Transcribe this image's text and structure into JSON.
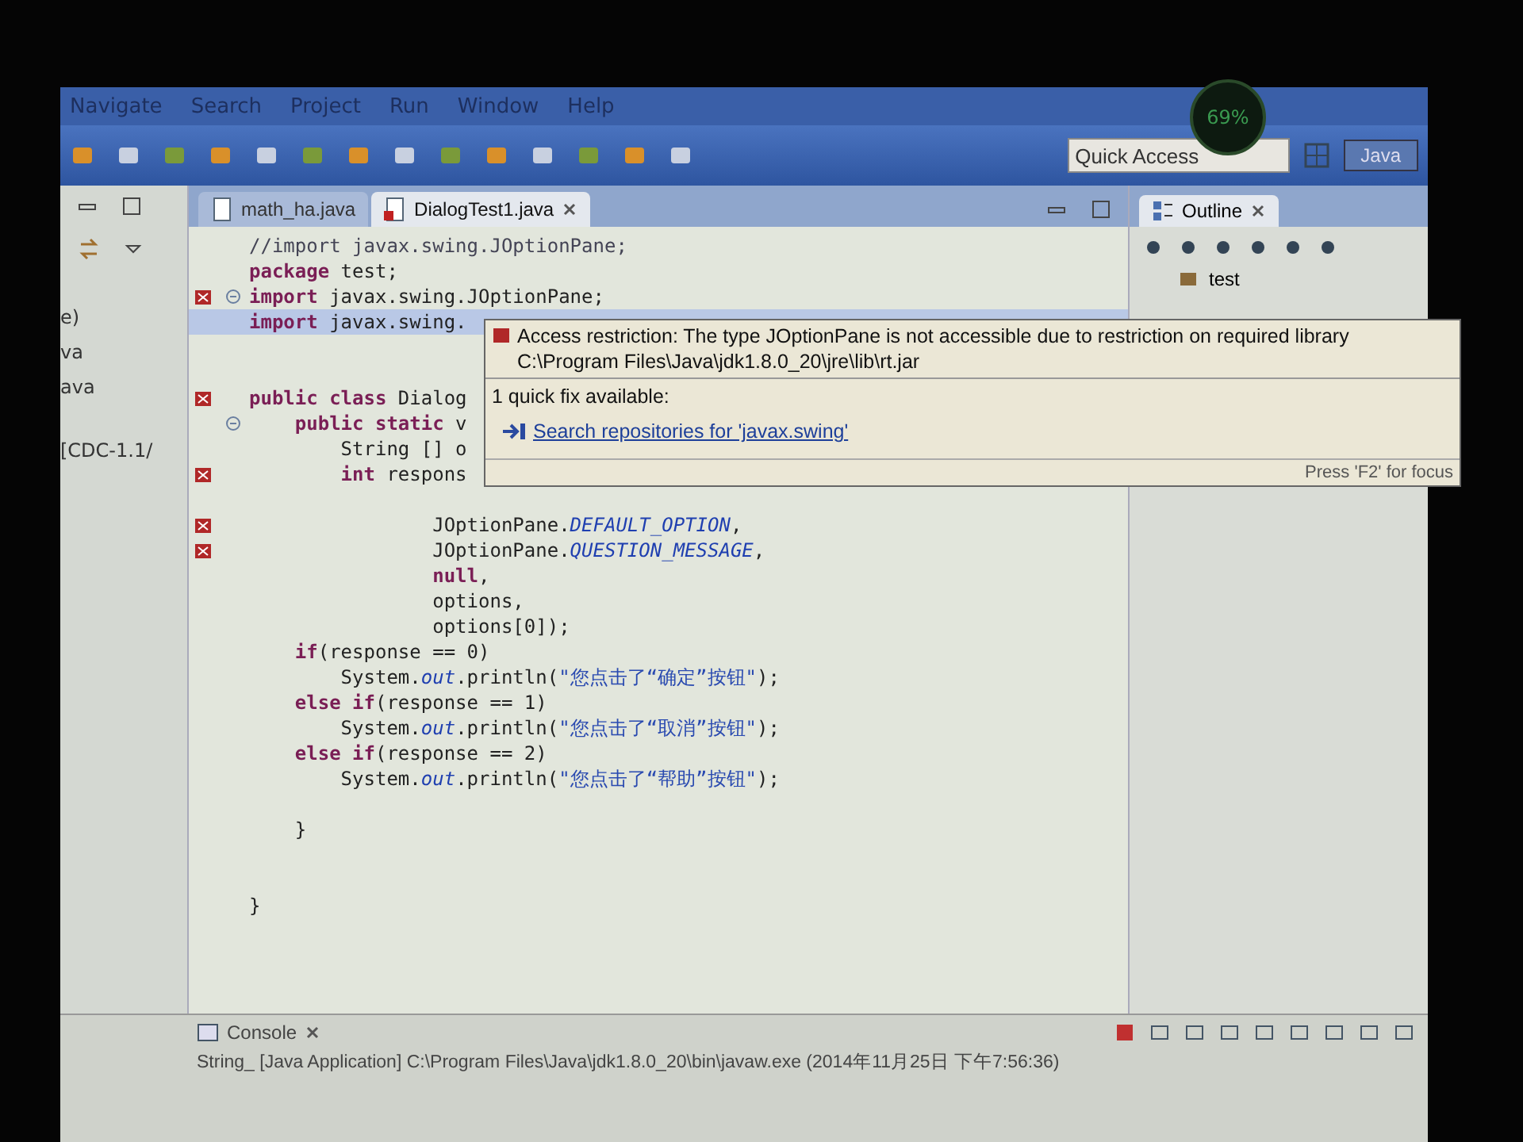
{
  "overlay_widget": {
    "percent": "69%"
  },
  "menu": [
    "Navigate",
    "Search",
    "Project",
    "Run",
    "Window",
    "Help"
  ],
  "quick_access": {
    "placeholder": "Quick Access"
  },
  "perspective": {
    "label": "Java"
  },
  "left_panel": {
    "items": [
      "e)",
      "va",
      "ava",
      "[CDC-1.1/"
    ]
  },
  "tabs": [
    {
      "label": "math_ha.java",
      "selected": false,
      "error": false
    },
    {
      "label": "DialogTest1.java",
      "selected": true,
      "error": true
    }
  ],
  "code_lines": [
    {
      "error": false,
      "fold": false,
      "selected": false,
      "tokens": [
        {
          "kind": "comment",
          "text": "//import javax.swing.JOptionPane;"
        }
      ]
    },
    {
      "error": false,
      "fold": false,
      "selected": false,
      "tokens": [
        {
          "kind": "keyword",
          "text": "package"
        },
        {
          "kind": "plain",
          "text": " test;"
        }
      ]
    },
    {
      "error": true,
      "fold": true,
      "selected": false,
      "tokens": [
        {
          "kind": "keyword",
          "text": "import"
        },
        {
          "kind": "plain",
          "text": " javax.swing.JOptionPane;"
        }
      ]
    },
    {
      "error": false,
      "fold": false,
      "selected": true,
      "tokens": [
        {
          "kind": "keyword",
          "text": "import"
        },
        {
          "kind": "plain",
          "text": " javax.swing."
        }
      ]
    },
    {
      "error": false,
      "fold": false,
      "selected": false
    },
    {
      "error": false,
      "fold": false,
      "selected": false
    },
    {
      "error": true,
      "fold": false,
      "selected": false,
      "tokens": [
        {
          "kind": "keyword",
          "text": "public class"
        },
        {
          "kind": "plain",
          "text": " Dialog"
        }
      ]
    },
    {
      "error": false,
      "fold": true,
      "selected": false,
      "tokens": [
        {
          "kind": "keyword",
          "text": "    public static"
        },
        {
          "kind": "plain",
          "text": " v"
        }
      ]
    },
    {
      "error": false,
      "fold": false,
      "selected": false,
      "tokens": [
        {
          "kind": "plain",
          "text": "        String [] o"
        }
      ]
    },
    {
      "error": true,
      "fold": false,
      "selected": false,
      "tokens": [
        {
          "kind": "keyword",
          "text": "        int"
        },
        {
          "kind": "plain",
          "text": " respons"
        }
      ]
    },
    {
      "error": false,
      "fold": false,
      "selected": false
    },
    {
      "error": true,
      "fold": false,
      "selected": false,
      "tokens": [
        {
          "kind": "plain",
          "text": "                JOptionPane."
        },
        {
          "kind": "field",
          "text": "DEFAULT_OPTION"
        },
        {
          "kind": "plain",
          "text": ","
        }
      ]
    },
    {
      "error": true,
      "fold": false,
      "selected": false,
      "tokens": [
        {
          "kind": "plain",
          "text": "                JOptionPane."
        },
        {
          "kind": "field",
          "text": "QUESTION_MESSAGE"
        },
        {
          "kind": "plain",
          "text": ","
        }
      ]
    },
    {
      "error": false,
      "fold": false,
      "selected": false,
      "tokens": [
        {
          "kind": "keyword",
          "text": "                null"
        },
        {
          "kind": "plain",
          "text": ","
        }
      ]
    },
    {
      "error": false,
      "fold": false,
      "selected": false,
      "tokens": [
        {
          "kind": "plain",
          "text": "                options,"
        }
      ]
    },
    {
      "error": false,
      "fold": false,
      "selected": false,
      "tokens": [
        {
          "kind": "plain",
          "text": "                options[0]);"
        }
      ]
    },
    {
      "error": false,
      "fold": false,
      "selected": false,
      "tokens": [
        {
          "kind": "keyword",
          "text": "    if"
        },
        {
          "kind": "plain",
          "text": "(response == 0)"
        }
      ]
    },
    {
      "error": false,
      "fold": false,
      "selected": false,
      "tokens": [
        {
          "kind": "plain",
          "text": "        System."
        },
        {
          "kind": "field",
          "text": "out"
        },
        {
          "kind": "plain",
          "text": ".println("
        },
        {
          "kind": "string",
          "text": "\"您点击了“确定”按钮\""
        },
        {
          "kind": "plain",
          "text": ");"
        }
      ]
    },
    {
      "error": false,
      "fold": false,
      "selected": false,
      "tokens": [
        {
          "kind": "keyword",
          "text": "    else if"
        },
        {
          "kind": "plain",
          "text": "(response == 1)"
        }
      ]
    },
    {
      "error": false,
      "fold": false,
      "selected": false,
      "tokens": [
        {
          "kind": "plain",
          "text": "        System."
        },
        {
          "kind": "field",
          "text": "out"
        },
        {
          "kind": "plain",
          "text": ".println("
        },
        {
          "kind": "string",
          "text": "\"您点击了“取消”按钮\""
        },
        {
          "kind": "plain",
          "text": ");"
        }
      ]
    },
    {
      "error": false,
      "fold": false,
      "selected": false,
      "tokens": [
        {
          "kind": "keyword",
          "text": "    else if"
        },
        {
          "kind": "plain",
          "text": "(response == 2)"
        }
      ]
    },
    {
      "error": false,
      "fold": false,
      "selected": false,
      "tokens": [
        {
          "kind": "plain",
          "text": "        System."
        },
        {
          "kind": "field",
          "text": "out"
        },
        {
          "kind": "plain",
          "text": ".println("
        },
        {
          "kind": "string",
          "text": "\"您点击了“帮助”按钮\""
        },
        {
          "kind": "plain",
          "text": ");"
        }
      ]
    },
    {
      "error": false,
      "fold": false,
      "selected": false
    },
    {
      "error": false,
      "fold": false,
      "selected": false,
      "tokens": [
        {
          "kind": "plain",
          "text": "    }"
        }
      ]
    },
    {
      "error": false,
      "fold": false,
      "selected": false
    },
    {
      "error": false,
      "fold": false,
      "selected": false
    },
    {
      "error": false,
      "fold": false,
      "selected": false,
      "tokens": [
        {
          "kind": "plain",
          "text": "}"
        }
      ]
    }
  ],
  "hover_popup": {
    "message": "Access restriction: The type JOptionPane is not accessible due to restriction on required library",
    "path": "C:\\Program Files\\Java\\jdk1.8.0_20\\jre\\lib\\rt.jar",
    "fix_count": "1 quick fix available:",
    "fixes": [
      "Search repositories for 'javax.swing'"
    ],
    "footer": "Press 'F2' for focus"
  },
  "outline": {
    "title": "Outline",
    "items": [
      "test"
    ]
  },
  "console": {
    "title": "Console",
    "launch": "String_ [Java Application] C:\\Program Files\\Java\\jdk1.8.0_20\\bin\\javaw.exe (2014年11月25日 下午7:56:36)"
  }
}
